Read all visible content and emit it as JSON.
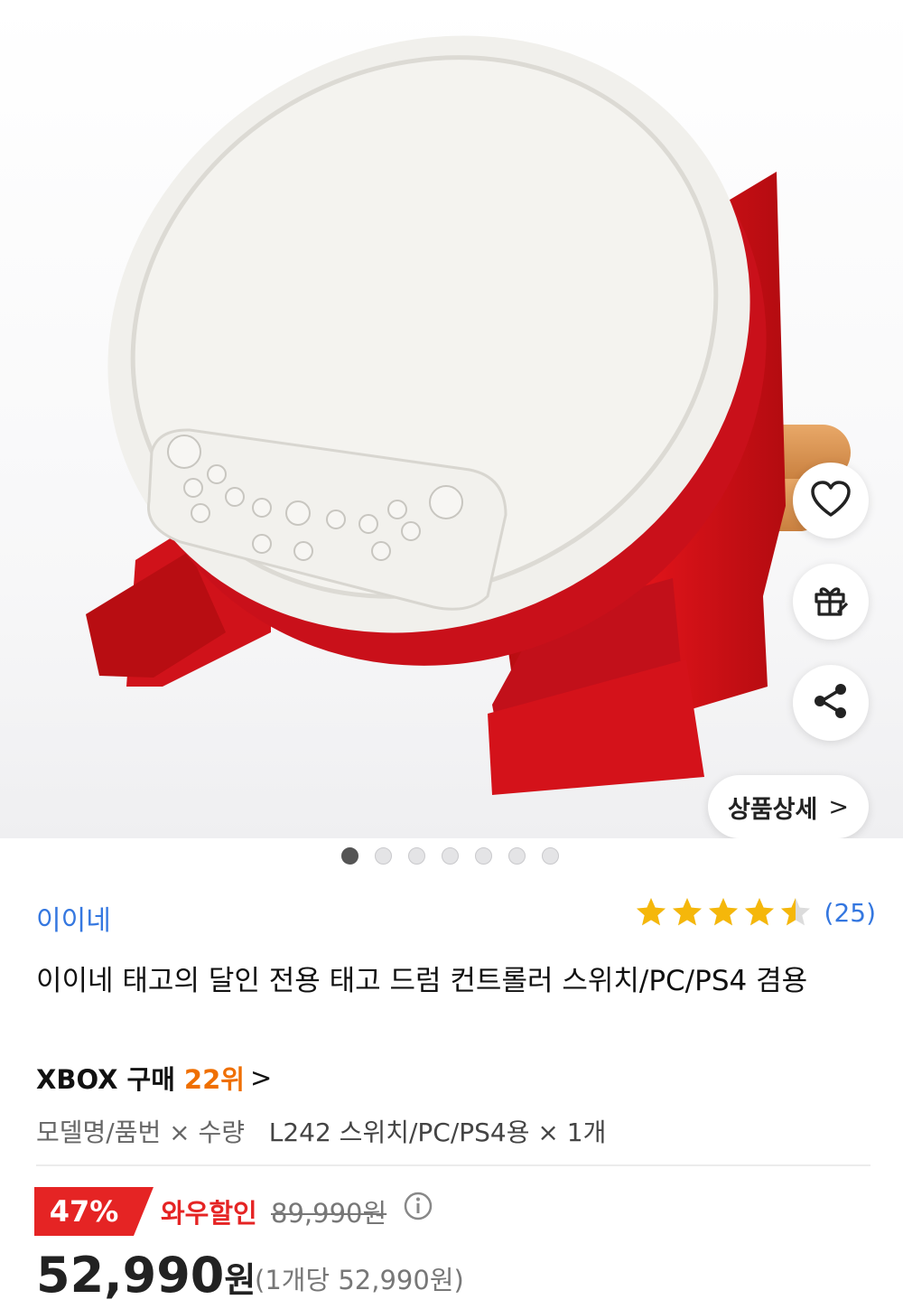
{
  "colors": {
    "brand_link": "#3477e0",
    "rank": "#ef6f00",
    "discount": "#e52424",
    "star": "#f5b70a"
  },
  "gallery": {
    "dots_total": 7,
    "active_index": 0
  },
  "actions": {
    "wishlist_icon": "heart-icon",
    "gift_icon": "gift-icon",
    "share_icon": "share-icon",
    "detail_label": "상품상세",
    "detail_arrow": ">"
  },
  "product": {
    "brand": "이이네",
    "rating": 4.5,
    "review_count": "(25)",
    "title": "이이네 태고의 달인 전용 태고 드럼 컨트롤러 스위치/PC/PS4 겸용",
    "rank_prefix": "XBOX 구매",
    "rank_value": "22위",
    "rank_arrow": ">",
    "option_label": "모델명/품번 × 수량",
    "option_value": "L242 스위치/PC/PS4용 × 1개"
  },
  "pricing": {
    "discount_rate": "47%",
    "wow_label": "와우할인",
    "original_price": "89,990원",
    "price": "52,990",
    "price_unit": "원",
    "unit_price": "(1개당 52,990원)"
  }
}
